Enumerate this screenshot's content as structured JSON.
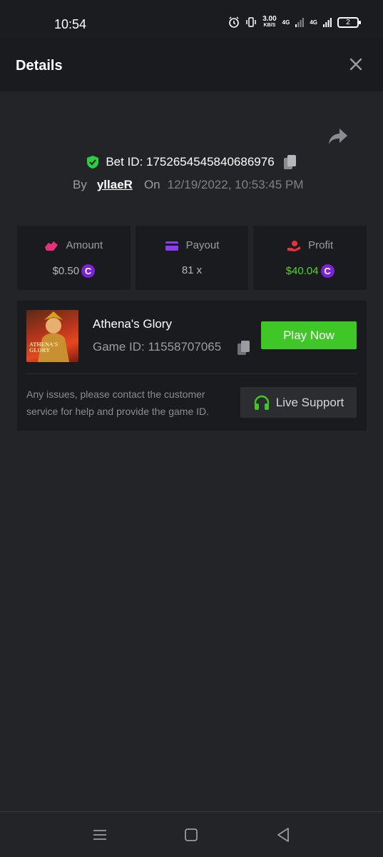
{
  "status_bar": {
    "time": "10:54",
    "net_speed": "3.00",
    "net_speed_unit": "KB/S",
    "network_1": "4G",
    "network_2": "4G",
    "battery": "2"
  },
  "header": {
    "title": "Details"
  },
  "bet": {
    "id_label": "Bet ID: 1752654545840686976",
    "by_label": "By",
    "username": "yllaeR",
    "on_label": "On",
    "datetime": "12/19/2022, 10:53:45 PM"
  },
  "stats": {
    "amount": {
      "label": "Amount",
      "value": "$0.50"
    },
    "payout": {
      "label": "Payout",
      "value": "81 x"
    },
    "profit": {
      "label": "Profit",
      "value": "$40.04"
    }
  },
  "game": {
    "name": "Athena's Glory",
    "id_label": "Game ID: 11558707065",
    "thumb_text_line1": "ATHENA'S",
    "thumb_text_line2": "GLORY",
    "play_button": "Play Now",
    "support_text": "Any issues, please contact the customer service for help and provide the game ID.",
    "support_button": "Live Support"
  },
  "colors": {
    "accent_green": "#3fc627",
    "profit_green": "#54d42c",
    "coin_purple": "#7b22d6",
    "amount_pink": "#e8307a",
    "payout_purple": "#8b3bf0",
    "profit_red": "#e8323a"
  },
  "icons": {
    "close": "close-icon",
    "share": "share-icon",
    "shield": "shield-check-icon",
    "copy": "copy-icon",
    "headset": "headset-icon"
  }
}
